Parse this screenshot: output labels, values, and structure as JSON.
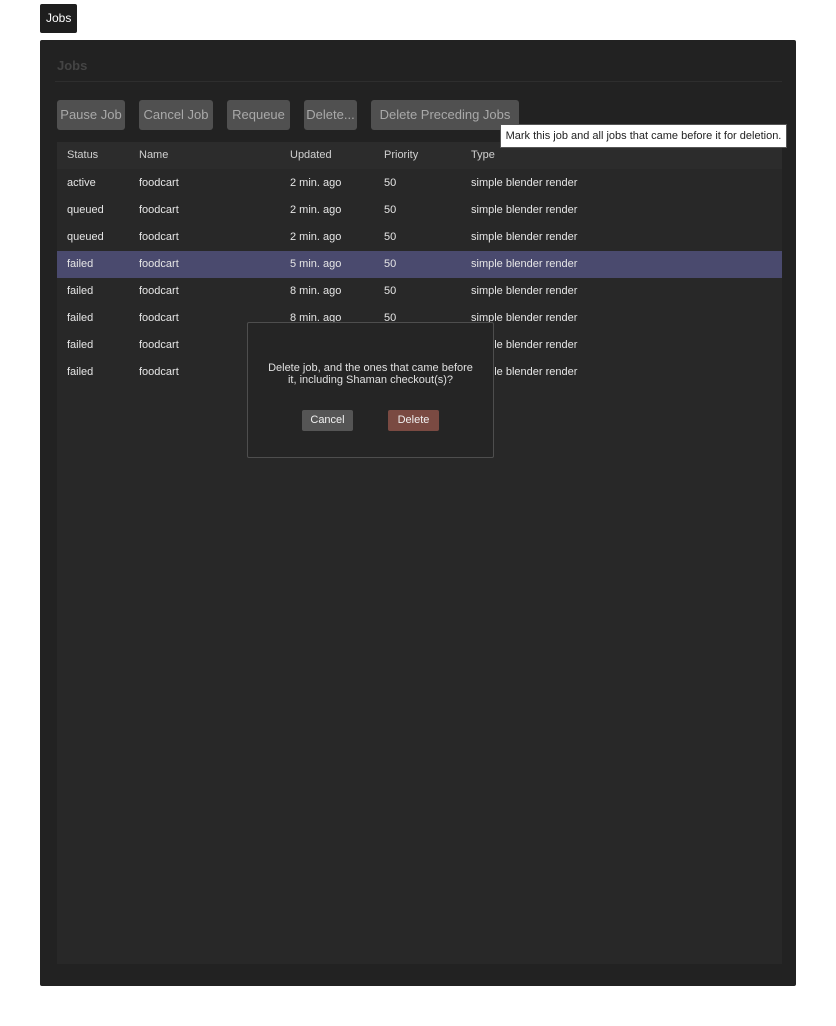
{
  "nav": {
    "jobs_tab": "Jobs"
  },
  "panel": {
    "title": "Jobs"
  },
  "toolbar": {
    "pause": "Pause Job",
    "cancel": "Cancel Job",
    "requeue": "Requeue",
    "delete": "Delete...",
    "delete_preceding": "Delete Preceding Jobs"
  },
  "tooltip": "Mark this job and all jobs that came before it for deletion.",
  "table": {
    "headers": {
      "status": "Status",
      "name": "Name",
      "updated": "Updated",
      "priority": "Priority",
      "type": "Type"
    },
    "rows": [
      {
        "status": "active",
        "name": "foodcart",
        "updated": "2 min. ago",
        "priority": "50",
        "type": "simple blender render",
        "selected": false
      },
      {
        "status": "queued",
        "name": "foodcart",
        "updated": "2 min. ago",
        "priority": "50",
        "type": "simple blender render",
        "selected": false
      },
      {
        "status": "queued",
        "name": "foodcart",
        "updated": "2 min. ago",
        "priority": "50",
        "type": "simple blender render",
        "selected": false
      },
      {
        "status": "failed",
        "name": "foodcart",
        "updated": "5 min. ago",
        "priority": "50",
        "type": "simple blender render",
        "selected": true
      },
      {
        "status": "failed",
        "name": "foodcart",
        "updated": "8 min. ago",
        "priority": "50",
        "type": "simple blender render",
        "selected": false
      },
      {
        "status": "failed",
        "name": "foodcart",
        "updated": "8 min. ago",
        "priority": "50",
        "type": "simple blender render",
        "selected": false
      },
      {
        "status": "failed",
        "name": "foodcart",
        "updated": "",
        "priority": "",
        "type": "simple blender render",
        "selected": false
      },
      {
        "status": "failed",
        "name": "foodcart",
        "updated": "",
        "priority": "",
        "type": "simple blender render",
        "selected": false
      }
    ]
  },
  "dialog": {
    "message": "Delete job, and the ones that came before it, including Shaman checkout(s)?",
    "cancel": "Cancel",
    "delete": "Delete"
  },
  "colors": {
    "selected_row": "#4a4a6e",
    "delete_button": "#7a4a42",
    "panel_bg": "#222222"
  }
}
